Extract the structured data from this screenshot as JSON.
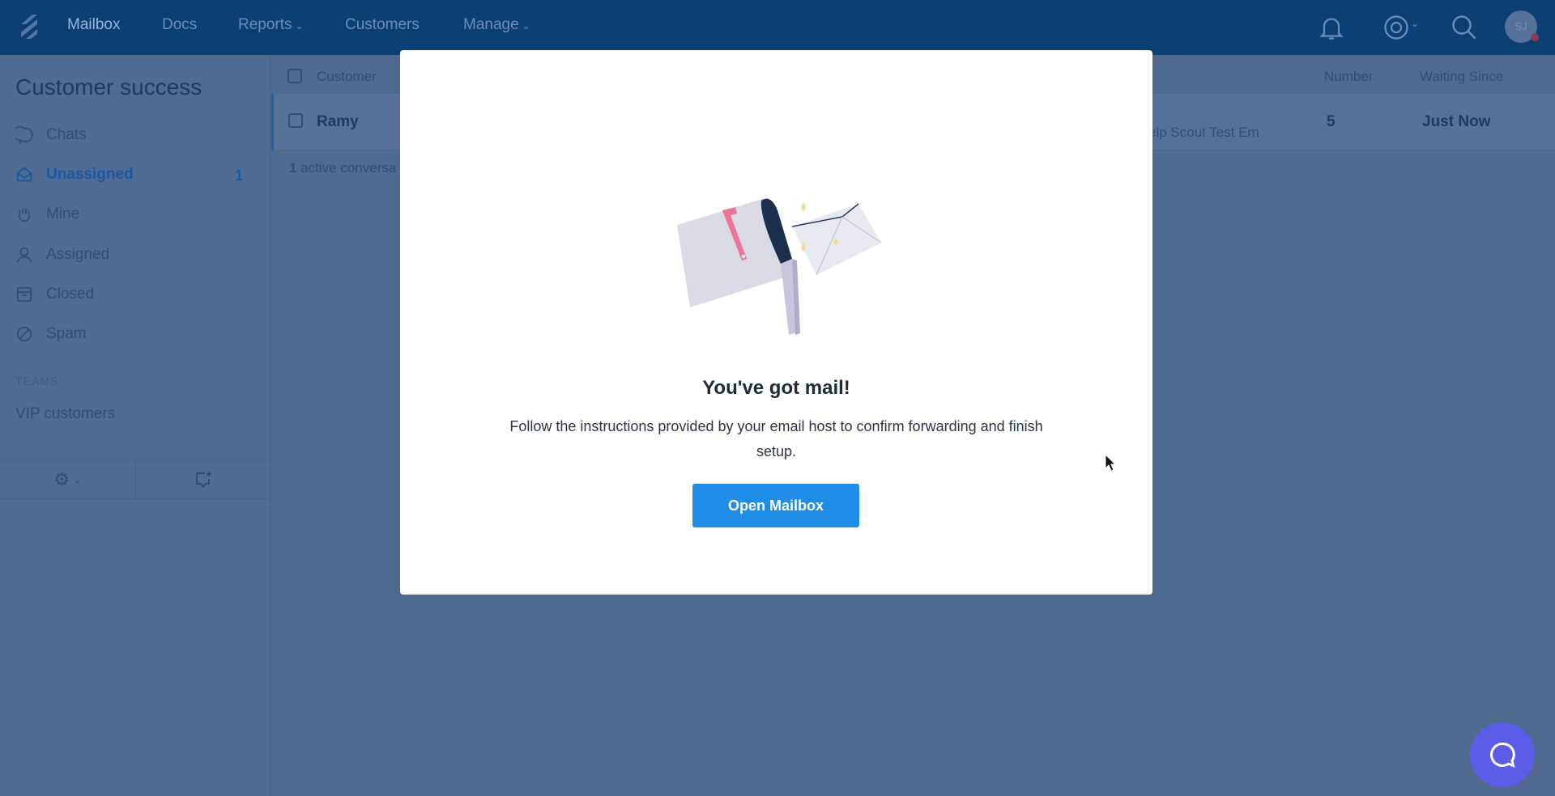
{
  "topbar": {
    "nav": [
      {
        "label": "Mailbox"
      },
      {
        "label": "Docs"
      },
      {
        "label": "Reports",
        "dropdown": true
      },
      {
        "label": "Customers"
      },
      {
        "label": "Manage",
        "dropdown": true
      }
    ],
    "avatar_initials": "SJ",
    "icons": [
      "logo-icon",
      "bell-icon",
      "lifesaver-icon",
      "search-icon"
    ]
  },
  "sidebar": {
    "title": "Customer success",
    "items": [
      {
        "label": "Chats",
        "icon": "chat-icon"
      },
      {
        "label": "Unassigned",
        "icon": "inbox-icon",
        "count": "1"
      },
      {
        "label": "Mine",
        "icon": "hand-icon"
      },
      {
        "label": "Assigned",
        "icon": "person-icon"
      },
      {
        "label": "Closed",
        "icon": "archive-icon"
      },
      {
        "label": "Spam",
        "icon": "ban-icon"
      }
    ],
    "teams_heading": "TEAMS",
    "teams": [
      {
        "label": "VIP customers"
      }
    ]
  },
  "table": {
    "headers": {
      "customer": "Customer",
      "number": "Number",
      "waiting": "Waiting Since"
    },
    "rows": [
      {
        "customer": "Ramy",
        "subject": "elp Scout Test Em",
        "number": "5",
        "waiting": "Just Now"
      }
    ],
    "footer_count": "1",
    "footer_text": " active conversa"
  },
  "modal": {
    "title": "You've got mail!",
    "text": "Follow the instructions provided by your email host to confirm forwarding and finish setup.",
    "button": "Open Mailbox"
  },
  "colors": {
    "accent": "#1f8ce6",
    "beacon": "#5b5de8",
    "header": "#0b4074"
  }
}
